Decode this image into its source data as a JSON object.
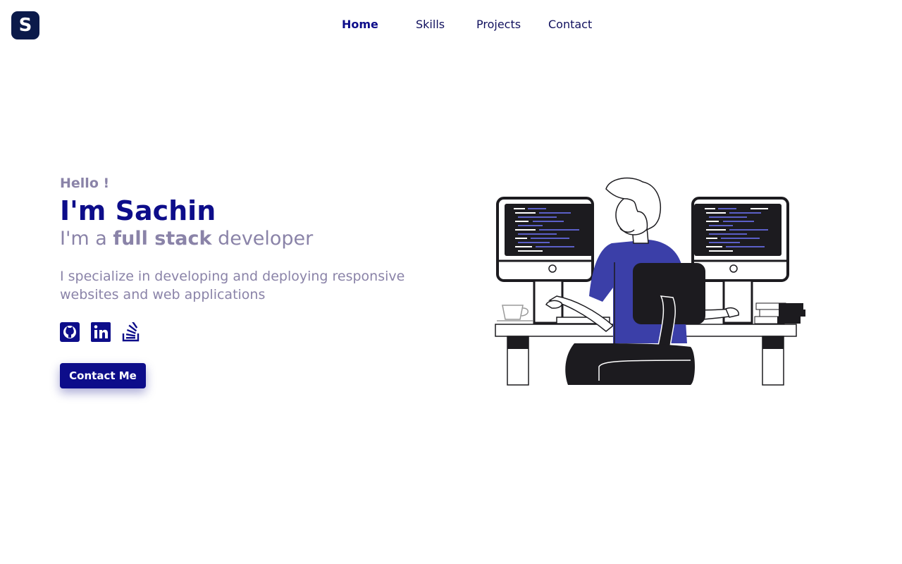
{
  "brand": {
    "logo_letter": "S"
  },
  "nav": {
    "items": [
      {
        "label": "Home",
        "active": true
      },
      {
        "label": "Skills",
        "active": false
      },
      {
        "label": "Projects",
        "active": false
      },
      {
        "label": "Contact",
        "active": false
      }
    ]
  },
  "hero": {
    "greeting": "Hello !",
    "name": "I'm Sachin",
    "role_prefix": "I'm a",
    "role_highlight": "full stack",
    "role_suffix": "developer",
    "description": "I specialize in developing and deploying responsive websites and web applications",
    "cta_label": "Contact Me"
  },
  "socials": [
    {
      "icon": "github-icon"
    },
    {
      "icon": "linkedin-icon"
    },
    {
      "icon": "stackoverflow-icon"
    }
  ],
  "colors": {
    "primary": "#0d0d8a",
    "muted": "#8a83a8",
    "logo_bg": "#0b1a4a",
    "accent_shirt": "#3b3fa8"
  }
}
